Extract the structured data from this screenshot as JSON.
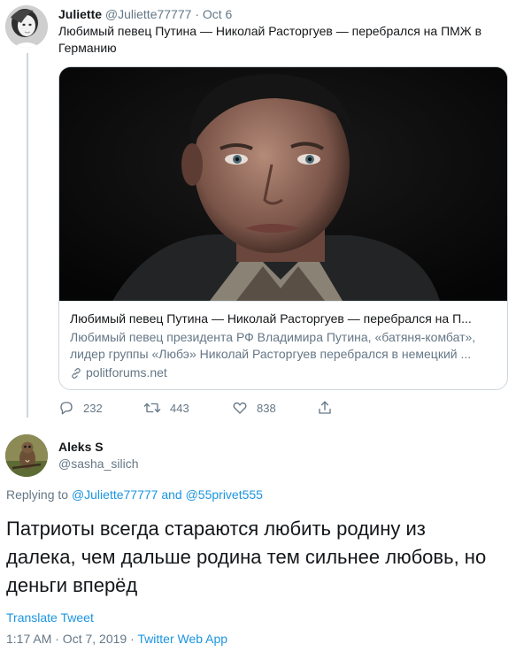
{
  "tweet1": {
    "name": "Juliette",
    "handle": "@Juliette77777",
    "separator": "·",
    "date": "Oct 6",
    "text": "Любимый певец Путина — Николай Расторгуев — перебрался на ПМЖ в Германию",
    "card": {
      "title": "Любимый певец Путина — Николай Расторгуев — перебрался на П...",
      "description_line1": "Любимый певец президента РФ Владимира Путина, «батяня-комбат»,",
      "description_line2": "лидер группы «Любэ» Николай Расторгуев перебрался в немецкий ...",
      "domain": "politforums.net"
    },
    "actions": {
      "replies": "232",
      "retweets": "443",
      "likes": "838"
    }
  },
  "tweet2": {
    "name": "Aleks S",
    "handle": "@sasha_silich",
    "replying_prefix": "Replying to",
    "replying_user1": "@Juliette77777",
    "replying_and": "and",
    "replying_user2": "@55privet555",
    "text_line1": "Патриоты всегда стараются любить родину из",
    "text_line2": "далека, чем дальше родина тем сильнее любовь, но",
    "text_line3": "деньги вперёд",
    "translate": "Translate Tweet",
    "timestamp": "1:17 AM · Oct 7, 2019 ·",
    "via": "Twitter Web App"
  },
  "colors": {
    "link": "#1b95e0",
    "secondary_text": "#657786",
    "border": "#ccd6dd"
  },
  "icons": [
    "reply-icon",
    "retweet-icon",
    "like-icon",
    "share-icon",
    "link-icon"
  ]
}
